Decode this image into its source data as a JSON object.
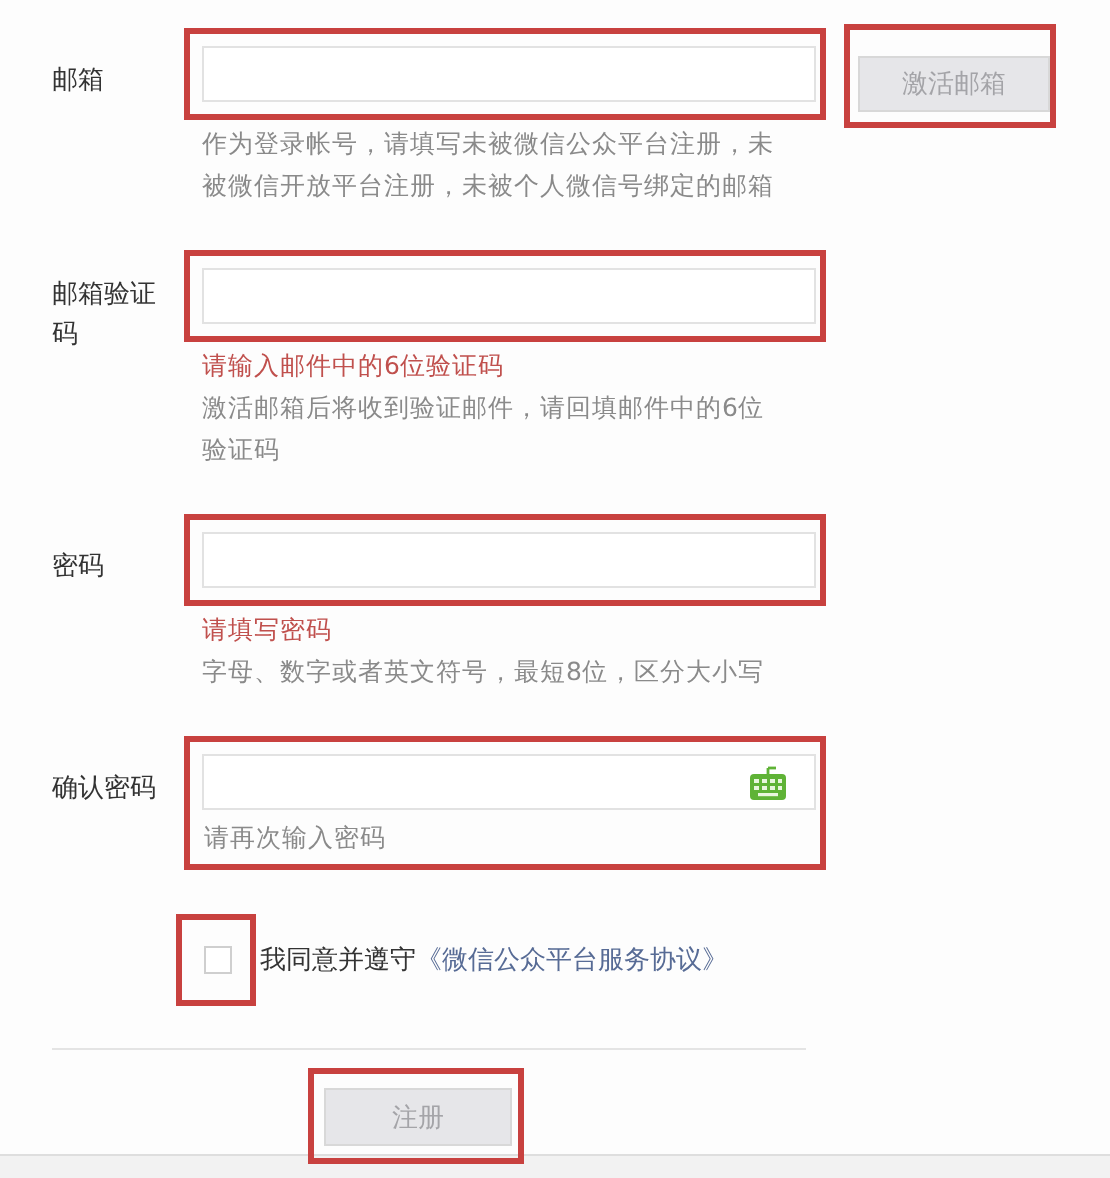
{
  "fields": [
    {
      "label": "邮箱",
      "highlighted": true,
      "frame_covers_messages": false,
      "keyboard": false,
      "messages": [
        {
          "kind": "hint",
          "text": "作为登录帐号，请填写未被微信公众平台注册，未被微信开放平台注册，未被个人微信号绑定的邮箱"
        }
      ],
      "action": {
        "label": "激活邮箱",
        "disabled": true,
        "highlighted": true
      }
    },
    {
      "label": "邮箱验证码",
      "highlighted": true,
      "frame_covers_messages": false,
      "keyboard": false,
      "messages": [
        {
          "kind": "error",
          "text": "请输入邮件中的6位验证码"
        },
        {
          "kind": "hint",
          "text": "激活邮箱后将收到验证邮件，请回填邮件中的6位验证码"
        }
      ]
    },
    {
      "label": "密码",
      "highlighted": true,
      "frame_covers_messages": false,
      "keyboard": false,
      "messages": [
        {
          "kind": "error",
          "text": "请填写密码"
        },
        {
          "kind": "hint",
          "text": "字母、数字或者英文符号，最短8位，区分大小写"
        }
      ]
    },
    {
      "label": "确认密码",
      "highlighted": true,
      "frame_covers_messages": true,
      "keyboard": true,
      "messages": [
        {
          "kind": "hint",
          "text": "请再次输入密码"
        }
      ]
    }
  ],
  "agreement": {
    "checked": false,
    "highlighted": true,
    "text": "我同意并遵守",
    "link": "《微信公众平台服务协议》"
  },
  "submit": {
    "label": "注册",
    "disabled": true,
    "highlighted": true
  }
}
